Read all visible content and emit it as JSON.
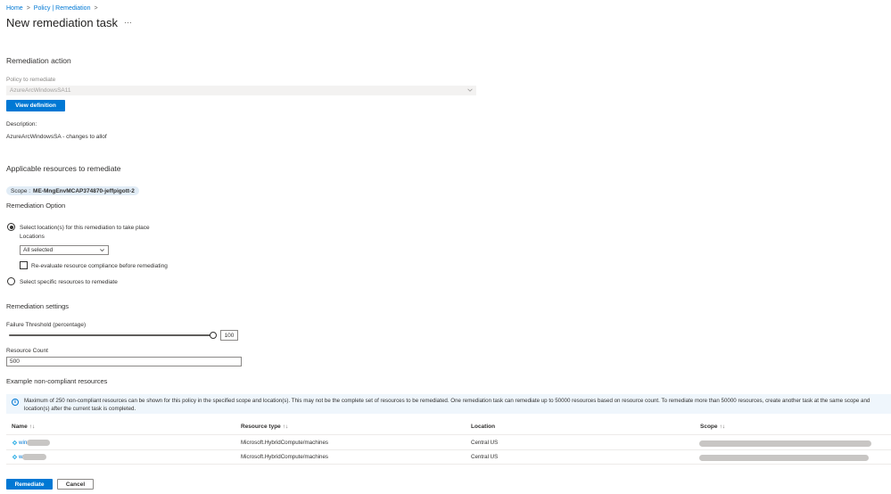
{
  "breadcrumb": {
    "home": "Home",
    "separator": ">",
    "policy": "Policy | Remediation"
  },
  "page": {
    "title": "New remediation task",
    "more": "···"
  },
  "remediation_action": {
    "heading": "Remediation action",
    "policy_label": "Policy to remediate",
    "policy_value": "AzureArcWindowsSA11",
    "view_definition": "View definition",
    "description_label": "Description:",
    "description_value": "AzureArcWindowsSA - changes to allof"
  },
  "applicable": {
    "heading": "Applicable resources to remediate",
    "scope_prefix": "Scope :",
    "scope_value": "ME-MngEnvMCAP374870-jeffpigott-2"
  },
  "option": {
    "heading": "Remediation Option",
    "radio_locations": "Select location(s) for this remediation to take place",
    "locations_label": "Locations",
    "locations_value": "All selected",
    "reevaluate_label": "Re-evaluate resource compliance before remediating",
    "radio_specific": "Select specific resources to remediate",
    "selected": "locations"
  },
  "settings": {
    "heading": "Remediation settings",
    "failure_threshold_label": "Failure Threshold (percentage)",
    "failure_threshold_value": "100",
    "failure_threshold_fraction": 1.0,
    "resource_count_label": "Resource Count",
    "resource_count_value": "500"
  },
  "examples": {
    "heading": "Example non-compliant resources",
    "info_text": "Maximum of 250 non-compliant resources can be shown for this policy in the specified scope and location(s). This may not be the complete set of resources to be remediated. One remediation task can remediate up to 50000 resources based on resource count. To remediate more than 50000 resources, create another task at the same scope and location(s) after the current task is completed.",
    "columns": [
      "Name",
      "Resource type",
      "Location",
      "Scope"
    ],
    "sort_glyph": "↑↓",
    "rows": [
      {
        "name_prefix": "win",
        "type": "Microsoft.HybridCompute/machines",
        "location": "Central US"
      },
      {
        "name_prefix": "w",
        "type": "Microsoft.HybridCompute/machines",
        "location": "Central US"
      }
    ]
  },
  "footer": {
    "remediate": "Remediate",
    "cancel": "Cancel"
  },
  "colors": {
    "accent": "#0078d4",
    "info_bg": "#eff6fc",
    "pill_bg": "#e1ecf6"
  }
}
